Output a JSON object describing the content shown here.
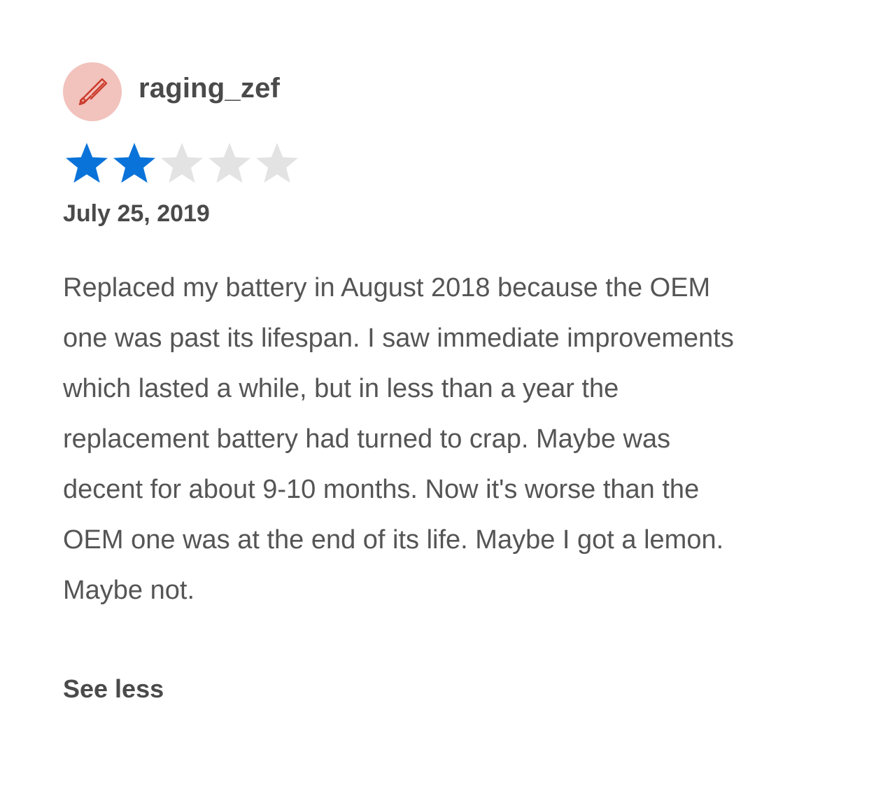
{
  "review": {
    "username": "raging_zef",
    "avatar_icon": "hacksaw-icon",
    "avatar_bg": "#f2c2bc",
    "avatar_icon_color": "#cc3d2e",
    "rating": 2,
    "rating_max": 5,
    "star_filled_color": "#0a73d9",
    "star_empty_color": "#e3e3e3",
    "date": "July 25, 2019",
    "body_lines": [
      "Replaced my battery in August 2018 because the OEM",
      "one was past its lifespan. I saw immediate improvements",
      "which lasted a while, but in less than a year the",
      "replacement battery had turned to crap. Maybe was",
      "decent for about 9-10 months. Now it's worse than the",
      "OEM one was at the end of its life. Maybe I got a lemon.",
      "Maybe not."
    ],
    "see_less_label": "See less"
  }
}
